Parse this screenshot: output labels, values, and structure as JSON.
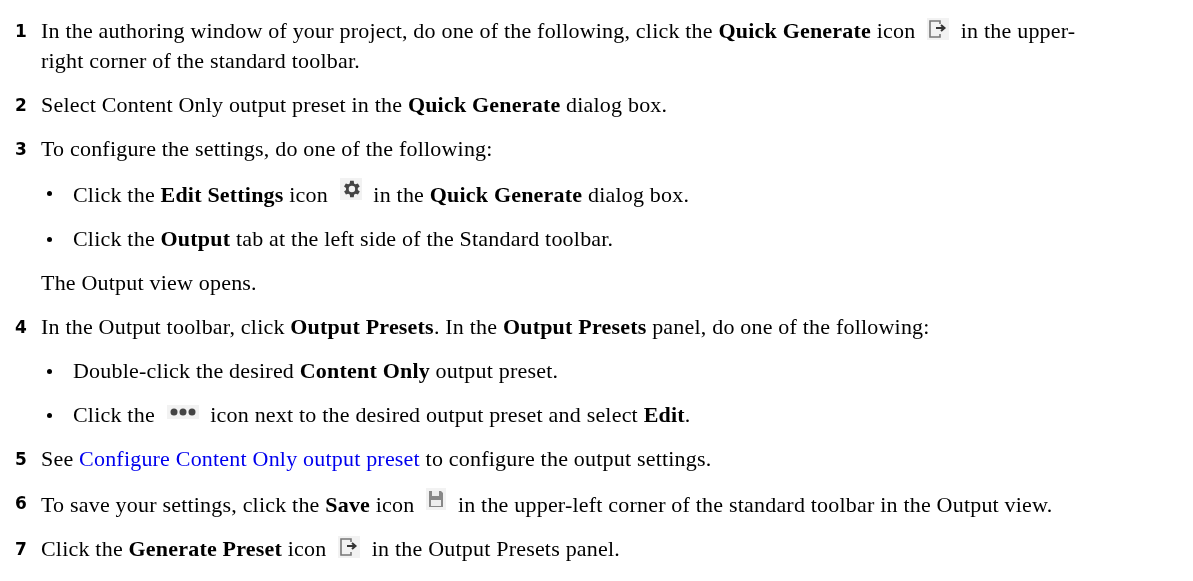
{
  "steps": [
    {
      "number": "1",
      "segments": [
        {
          "kind": "text",
          "text": "In the authoring window of your project, do one of the following, click the **Quick Generate** icon"
        },
        {
          "kind": "export"
        },
        {
          "kind": "text",
          "text": "in the upper-"
        },
        {
          "kind": "text",
          "text": "right corner of the standard toolbar."
        }
      ]
    },
    {
      "number": "2",
      "segments": [
        {
          "kind": "text",
          "text": "Select Content Only output preset in the **Quick Generate** dialog box."
        }
      ]
    },
    {
      "number": "3",
      "segments": [
        {
          "kind": "text",
          "text": "To configure the settings, do one of the following:"
        }
      ],
      "bullets": [
        {
          "segments": [
            {
              "kind": "text",
              "text": "Click the **Edit Settings** icon"
            },
            {
              "kind": "gear"
            },
            {
              "kind": "text",
              "text": "in the **Quick Generate** dialog box."
            }
          ]
        },
        {
          "segments": [
            {
              "kind": "text",
              "text": "Click the **Output** tab at the left side of the Standard toolbar."
            }
          ]
        }
      ],
      "note": "The Output view opens."
    },
    {
      "number": "4",
      "segments": [
        {
          "kind": "text",
          "text": "In the Output toolbar, click **Output Presets**.  In the **Output Presets** panel, do one of the following:"
        }
      ],
      "bullets": [
        {
          "segments": [
            {
              "kind": "text",
              "text": "Double-click the desired **Content Only** output preset."
            }
          ]
        },
        {
          "segments": [
            {
              "kind": "text",
              "text": "Click the"
            },
            {
              "kind": "dots"
            },
            {
              "kind": "text",
              "text": "icon next to the desired output preset and select **Edit**."
            }
          ]
        }
      ]
    },
    {
      "number": "5",
      "segments": [
        {
          "kind": "text",
          "text": "See"
        },
        {
          "kind": "link",
          "text": "Configure Content Only output preset"
        },
        {
          "kind": "text",
          "text": "to configure the output settings."
        }
      ]
    },
    {
      "number": "6",
      "segments": [
        {
          "kind": "text",
          "text": "To save your settings, click the **Save** icon"
        },
        {
          "kind": "save"
        },
        {
          "kind": "text",
          "text": "in the upper-left corner of the standard toolbar in the Output view."
        }
      ]
    },
    {
      "number": "7",
      "segments": [
        {
          "kind": "text",
          "text": "Click the **Generate Preset** icon"
        },
        {
          "kind": "export"
        },
        {
          "kind": "text",
          "text": "in the Output Presets panel."
        }
      ]
    }
  ]
}
